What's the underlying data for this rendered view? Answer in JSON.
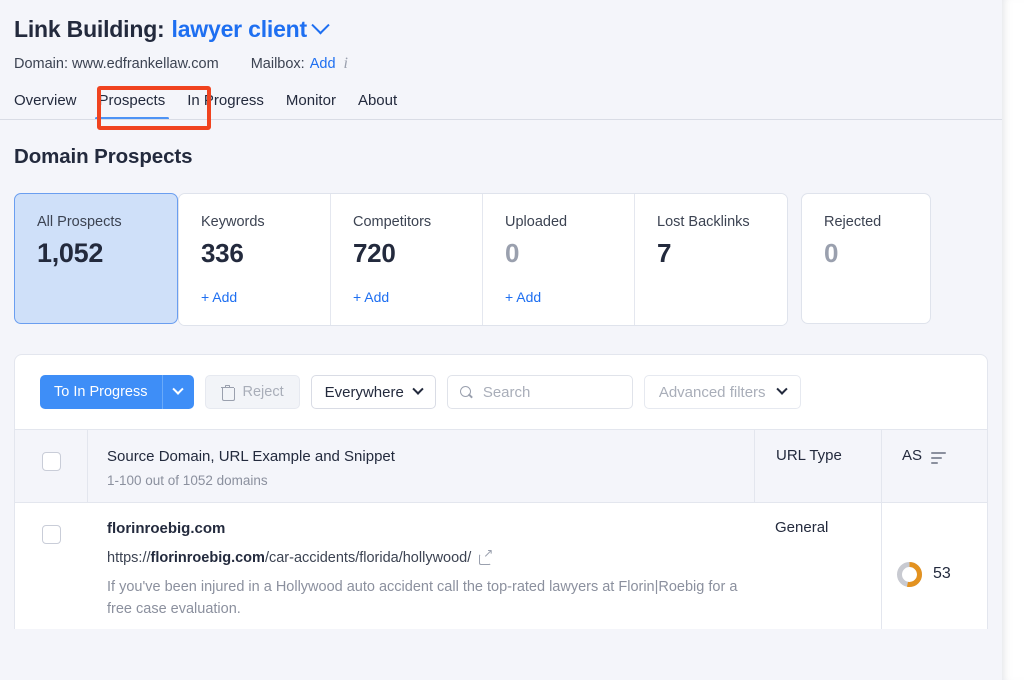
{
  "header": {
    "title_prefix": "Link Building:",
    "project_name": "lawyer client",
    "domain_label": "Domain: www.edfrankellaw.com",
    "mailbox_label": "Mailbox:",
    "mailbox_add": "Add"
  },
  "tabs": [
    {
      "label": "Overview",
      "active": false
    },
    {
      "label": "Prospects",
      "active": true
    },
    {
      "label": "In Progress",
      "active": false
    },
    {
      "label": "Monitor",
      "active": false
    },
    {
      "label": "About",
      "active": false
    }
  ],
  "section": {
    "title": "Domain Prospects"
  },
  "stats": [
    {
      "label": "All Prospects",
      "value": "1,052",
      "add": null,
      "selected": true,
      "muted": false
    },
    {
      "label": "Keywords",
      "value": "336",
      "add": "+ Add",
      "selected": false,
      "muted": false
    },
    {
      "label": "Competitors",
      "value": "720",
      "add": "+ Add",
      "selected": false,
      "muted": false
    },
    {
      "label": "Uploaded",
      "value": "0",
      "add": "+ Add",
      "selected": false,
      "muted": true
    },
    {
      "label": "Lost Backlinks",
      "value": "7",
      "add": null,
      "selected": false,
      "muted": false
    },
    {
      "label": "Rejected",
      "value": "0",
      "add": null,
      "selected": false,
      "muted": true
    }
  ],
  "toolbar": {
    "to_in_progress_label": "To In Progress",
    "reject_label": "Reject",
    "scope_label": "Everywhere",
    "search_placeholder": "Search",
    "search_value": "",
    "advanced_filters_label": "Advanced filters"
  },
  "table": {
    "columns": {
      "main_header": "Source Domain, URL Example and Snippet",
      "main_subheader": "1-100 out of 1052 domains",
      "url_type": "URL Type",
      "as": "AS"
    },
    "rows": [
      {
        "domain": "florinroebig.com",
        "url_prefix": "https://",
        "url_domain": "florinroebig.com",
        "url_path": "/car-accidents/florida/hollywood/",
        "snippet": "If you've been injured in a Hollywood auto accident call the top-rated lawyers at Florin|Roebig for a free case evaluation.",
        "url_type": "General",
        "as_score": "53",
        "as_percent": 53
      }
    ]
  },
  "colors": {
    "accent_blue": "#3e8ef7",
    "link_blue": "#1e6ff1",
    "annotation_red": "#f0431f",
    "gauge_orange": "#e39220",
    "gauge_track": "#c8cad1"
  }
}
